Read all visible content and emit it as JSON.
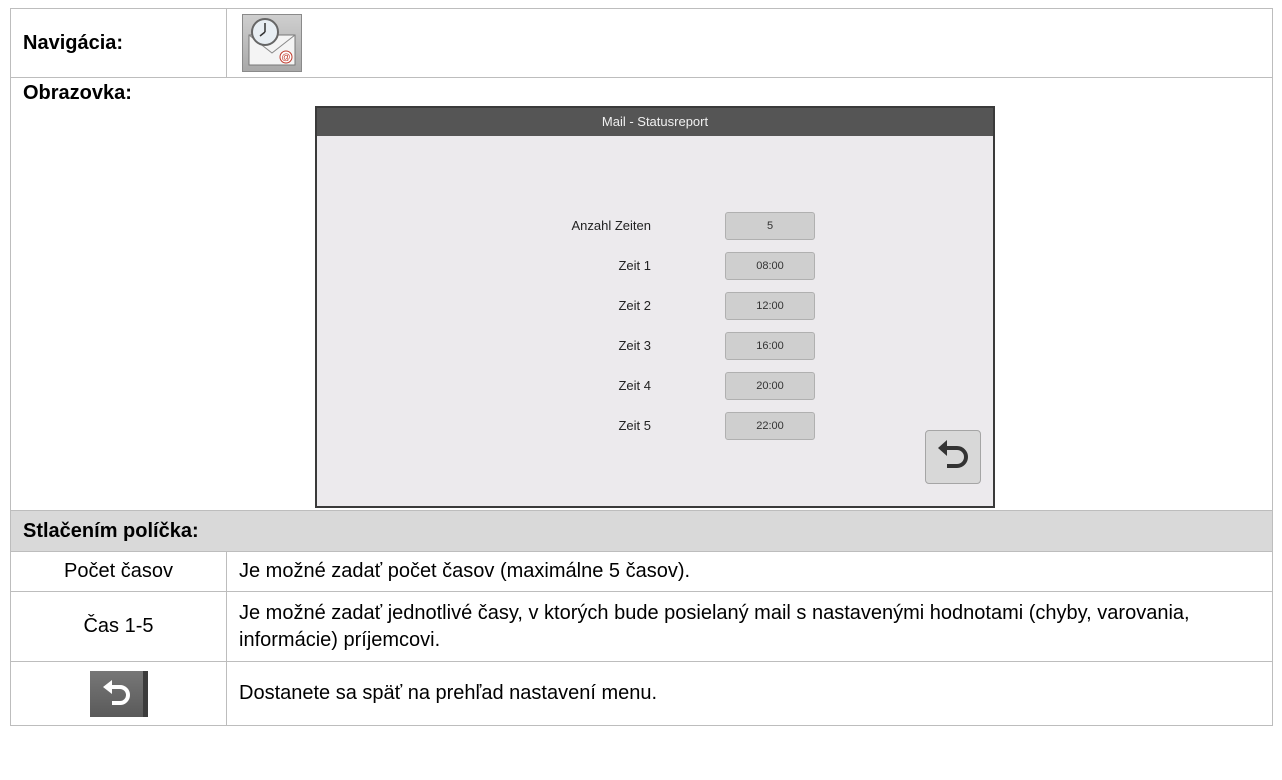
{
  "navigation": {
    "label": "Navigácia:",
    "icon": "clock-mail-icon"
  },
  "screen": {
    "label": "Obrazovka:",
    "hmi": {
      "title": "Mail - Statusreport",
      "rows": [
        {
          "label": "Anzahl Zeiten",
          "value": "5"
        },
        {
          "label": "Zeit 1",
          "value": "08:00"
        },
        {
          "label": "Zeit 2",
          "value": "12:00"
        },
        {
          "label": "Zeit 3",
          "value": "16:00"
        },
        {
          "label": "Zeit 4",
          "value": "20:00"
        },
        {
          "label": "Zeit 5",
          "value": "22:00"
        }
      ],
      "back_icon": "back-arrow-icon"
    }
  },
  "section": {
    "title": "Stlačením políčka:"
  },
  "table": [
    {
      "key": "Počet časov",
      "desc": "Je možné zadať počet časov  (maximálne 5 časov)."
    },
    {
      "key": "Čas 1-5",
      "desc": "Je možné zadať jednotlivé časy, v ktorých bude posielaný mail s nastavenými hodnotami (chyby, varovania, informácie) príjemcovi."
    },
    {
      "key_icon": "back-arrow-icon",
      "desc": "Dostanete sa späť na prehľad nastavení menu."
    }
  ]
}
